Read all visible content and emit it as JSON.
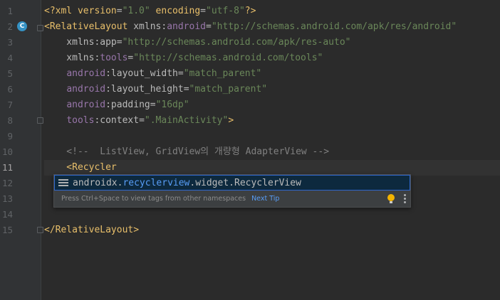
{
  "editor": {
    "line_numbers": [
      "1",
      "2",
      "3",
      "4",
      "5",
      "6",
      "7",
      "8",
      "9",
      "10",
      "11",
      "12",
      "13",
      "14",
      "15"
    ],
    "current_line": 11,
    "gutter_badge": "C",
    "lines": {
      "l1": {
        "p1": "<?",
        "p2": "xml version",
        "p3": "=",
        "p4": "\"1.0\"",
        "p5": " encoding",
        "p6": "=",
        "p7": "\"utf-8\"",
        "p8": "?>"
      },
      "l2": {
        "p1": "<RelativeLayout ",
        "p2": "xmlns:",
        "p3": "android",
        "p4": "=",
        "p5": "\"http://schemas.android.com/apk/res/android\""
      },
      "l3": {
        "p1": "    xmlns:",
        "p2": "app",
        "p3": "=",
        "p4": "\"http://schemas.android.com/apk/res-auto\""
      },
      "l4": {
        "p1": "    xmlns:",
        "p2": "tools",
        "p3": "=",
        "p4": "\"http://schemas.android.com/tools\""
      },
      "l5": {
        "p1": "    ",
        "p2": "android",
        "p3": ":layout_width",
        "p4": "=",
        "p5": "\"match_parent\""
      },
      "l6": {
        "p1": "    ",
        "p2": "android",
        "p3": ":layout_height",
        "p4": "=",
        "p5": "\"match_parent\""
      },
      "l7": {
        "p1": "    ",
        "p2": "android",
        "p3": ":padding",
        "p4": "=",
        "p5": "\"16dp\""
      },
      "l8": {
        "p1": "    ",
        "p2": "tools",
        "p3": ":context",
        "p4": "=",
        "p5": "\".MainActivity\"",
        "p6": ">"
      },
      "l10": {
        "p1": "    <!--  ListView, GridView의 개량형 AdapterView -->"
      },
      "l11": {
        "p1": "    <",
        "p2": "Recycler"
      },
      "l15": {
        "p1": "</RelativeLayout>"
      }
    }
  },
  "autocomplete": {
    "item_prefix": "androidx.",
    "item_match": "recyclerview",
    "item_suffix": ".widget.RecyclerView",
    "hint": "Press Ctrl+Space to view tags from other namespaces",
    "next_tip": "Next Tip",
    "item_icon": "list-icon",
    "tip_icon": "lightbulb-icon",
    "more_icon": "kebab-menu-icon"
  },
  "colors": {
    "background": "#2b2b2b",
    "tag": "#e8bf6a",
    "namespace": "#9876aa",
    "string": "#6a8759",
    "comment": "#808080",
    "match": "#589df6"
  }
}
